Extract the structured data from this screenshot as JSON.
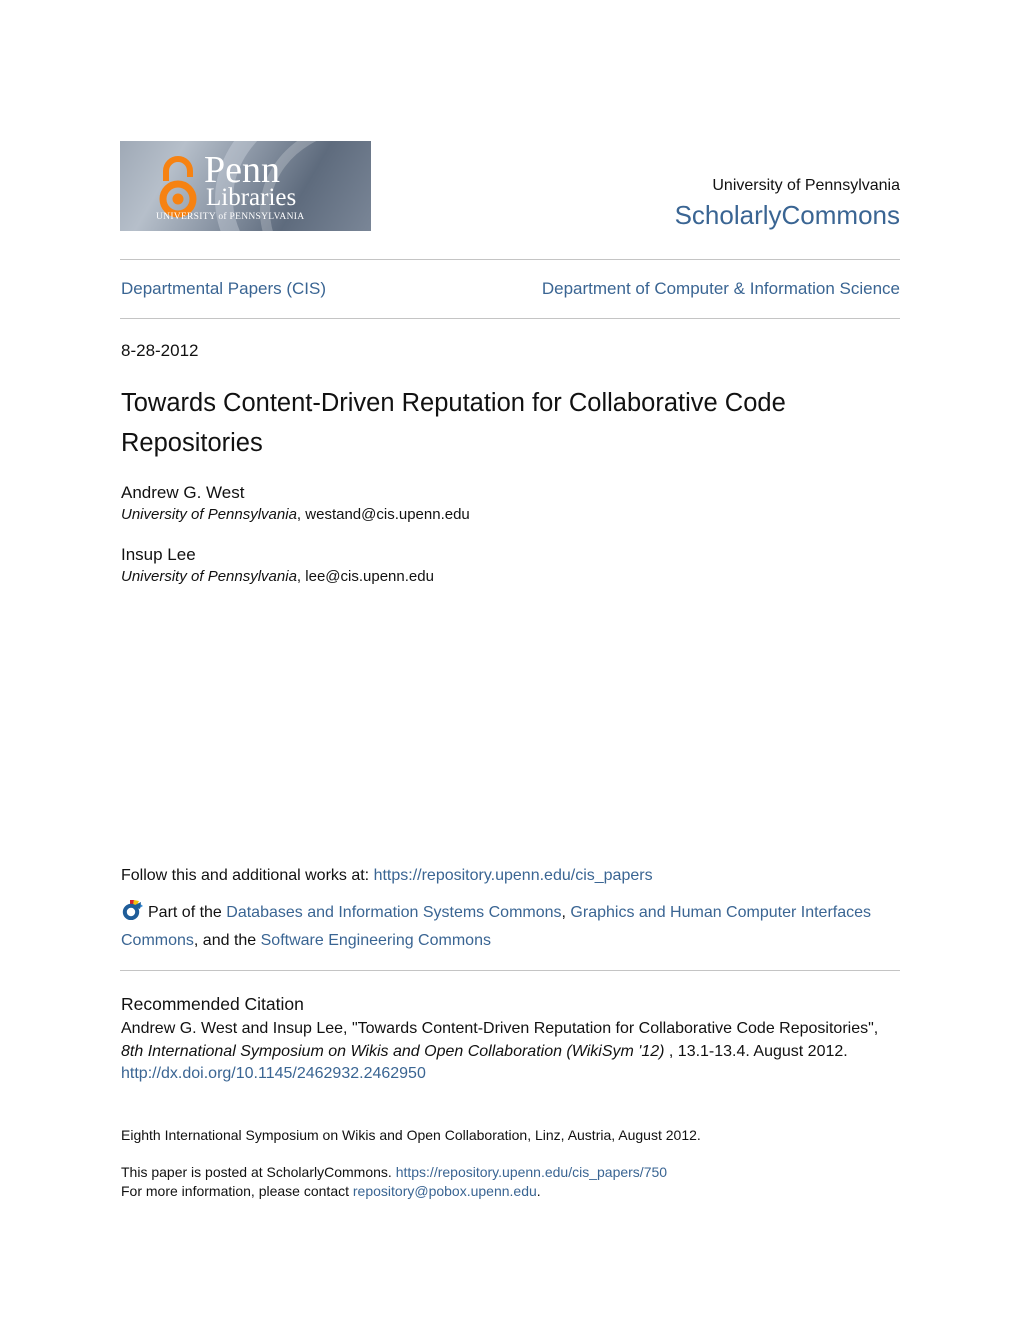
{
  "logo": {
    "line1": "Penn",
    "line2": "Libraries",
    "line3": "UNIVERSITY of PENNSYLVANIA",
    "colors": {
      "open_access_orange": "#f68212"
    }
  },
  "header": {
    "university": "University of Pennsylvania",
    "repository_name": "ScholarlyCommons"
  },
  "nav": {
    "series": "Departmental Papers (CIS)",
    "department": "Department of Computer & Information Science"
  },
  "paper": {
    "date": "8-28-2012",
    "title": "Towards Content-Driven Reputation for Collaborative Code Repositories",
    "authors": [
      {
        "name": "Andrew G. West",
        "affiliation": "University of Pennsylvania",
        "email": "westand@cis.upenn.edu"
      },
      {
        "name": "Insup Lee",
        "affiliation": "University of Pennsylvania",
        "email": "lee@cis.upenn.edu"
      }
    ]
  },
  "follow": {
    "prefix": "Follow this and additional works at: ",
    "url": "https://repository.upenn.edu/cis_papers"
  },
  "part_of": {
    "prefix": "Part of the ",
    "commons": [
      "Databases and Information Systems Commons",
      "Graphics and Human Computer Interfaces Commons",
      "Software Engineering Commons"
    ],
    "sep1": ", ",
    "sep2": ", and the "
  },
  "citation": {
    "heading": "Recommended Citation",
    "text_main": "Andrew G. West and Insup Lee, \"Towards Content-Driven Reputation for Collaborative Code Repositories\",",
    "venue": "8th International Symposium on Wikis and Open Collaboration (WikiSym '12)",
    "details": " , 13.1-13.4. August 2012.",
    "doi": "http://dx.doi.org/10.1145/2462932.2462950"
  },
  "footer": {
    "event_note": "Eighth International Symposium on Wikis and Open Collaboration, Linz, Austria, August 2012.",
    "posted_prefix": "This paper is posted at ScholarlyCommons. ",
    "posted_url": "https://repository.upenn.edu/cis_papers/750",
    "contact_prefix": "For more information, please contact ",
    "contact_email": "repository@pobox.upenn.edu",
    "contact_suffix": "."
  },
  "colors": {
    "link": "#3a6593",
    "text": "#111111",
    "rule": "#c4c4c4"
  }
}
